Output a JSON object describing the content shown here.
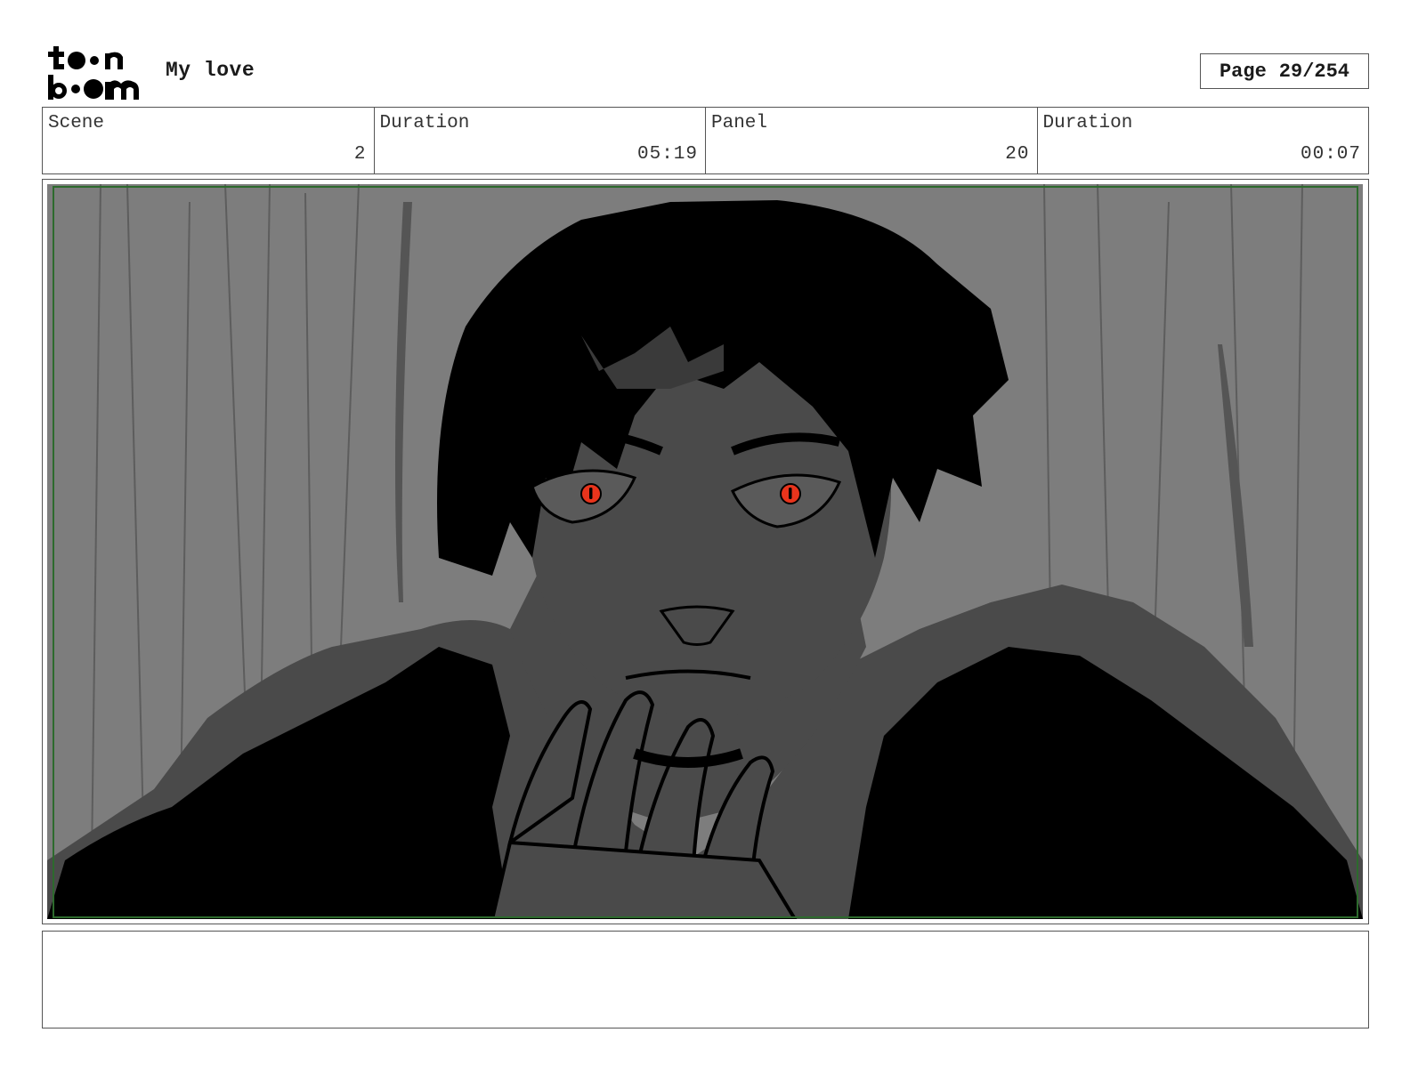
{
  "header": {
    "project_title": "My love",
    "page_label": "Page",
    "page_number": "29/254"
  },
  "info": {
    "scene_label": "Scene",
    "scene_value": "2",
    "scene_duration_label": "Duration",
    "scene_duration_value": "05:19",
    "panel_label": "Panel",
    "panel_value": "20",
    "panel_duration_label": "Duration",
    "panel_duration_value": "00:07"
  },
  "panel": {
    "eye_color": "#e8341c",
    "background_gray": "#7d7d7d",
    "shadow_gray": "#4a4a4a",
    "ink": "#000000",
    "safe_frame_color": "#2d6a2d"
  },
  "notes": {
    "text": ""
  }
}
